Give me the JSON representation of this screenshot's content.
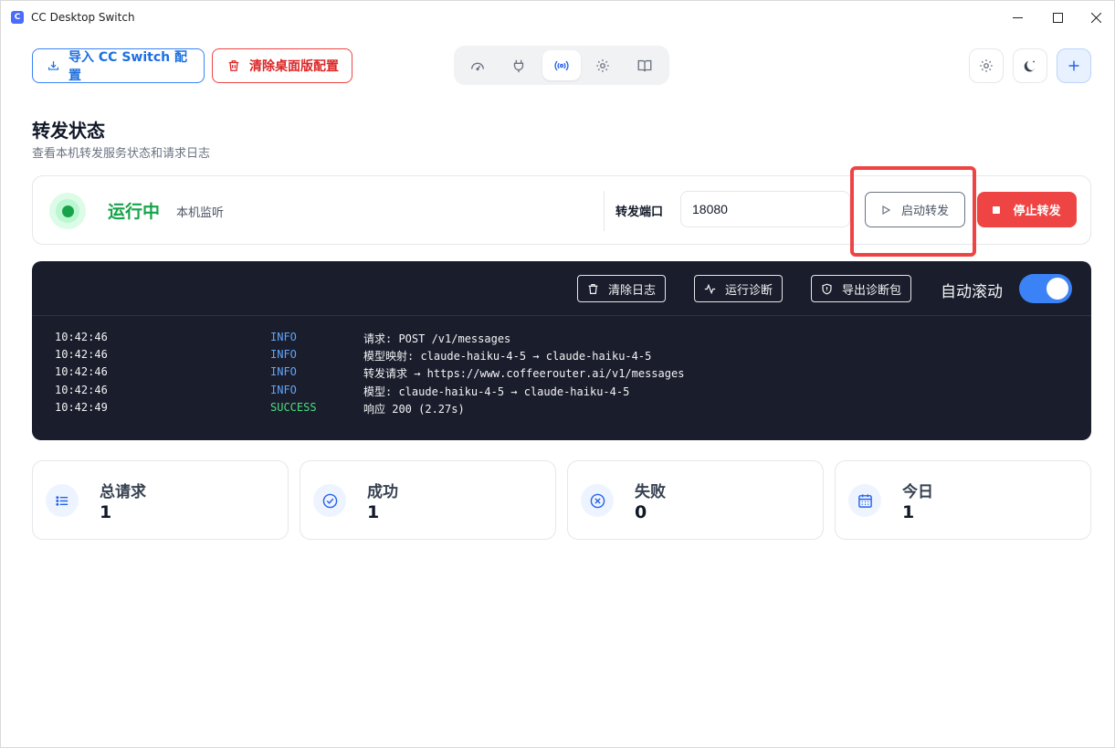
{
  "window": {
    "title": "CC Desktop Switch",
    "app_icon_glyph": "C"
  },
  "toolbar": {
    "import_label": "导入 CC Switch 配置",
    "clear_label": "清除桌面版配置",
    "nav_icons": [
      "dashboard-icon",
      "plug-icon",
      "broadcast-icon",
      "gear-icon",
      "book-icon"
    ],
    "active_nav": "broadcast-icon"
  },
  "header": {
    "title": "转发状态",
    "subtitle": "查看本机转发服务状态和请求日志"
  },
  "status": {
    "state": "运行中",
    "scope": "本机监听",
    "port_label": "转发端口",
    "port_value": "18080",
    "start_label": "启动转发",
    "stop_label": "停止转发",
    "running_color": "#16a34a",
    "stop_color": "#ef4444"
  },
  "log_panel": {
    "clear_label": "清除日志",
    "diagnose_label": "运行诊断",
    "export_label": "导出诊断包",
    "autoscroll_label": "自动滚动",
    "autoscroll_on": true,
    "lines": [
      {
        "time": "10:42:46",
        "level": "INFO",
        "message": "请求: POST /v1/messages"
      },
      {
        "time": "10:42:46",
        "level": "INFO",
        "message": "模型映射: claude-haiku-4-5 → claude-haiku-4-5"
      },
      {
        "time": "10:42:46",
        "level": "INFO",
        "message": "转发请求 → https://www.coffeerouter.ai/v1/messages"
      },
      {
        "time": "10:42:46",
        "level": "INFO",
        "message": "模型: claude-haiku-4-5 → claude-haiku-4-5"
      },
      {
        "time": "10:42:49",
        "level": "SUCCESS",
        "message": "响应 200 (2.27s)"
      }
    ]
  },
  "stats": [
    {
      "label": "总请求",
      "value": "1",
      "icon": "list-icon"
    },
    {
      "label": "成功",
      "value": "1",
      "icon": "check-circle-icon"
    },
    {
      "label": "失败",
      "value": "0",
      "icon": "x-circle-icon"
    },
    {
      "label": "今日",
      "value": "1",
      "icon": "calendar-icon"
    }
  ]
}
